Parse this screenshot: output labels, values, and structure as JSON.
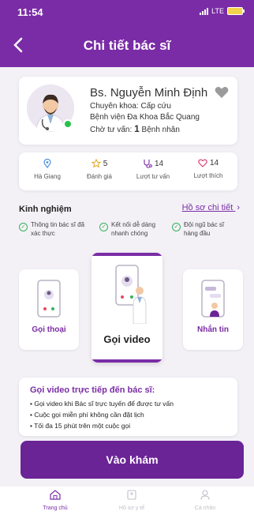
{
  "status_bar": {
    "time": "11:54",
    "network": "LTE"
  },
  "header": {
    "title": "Chi tiết bác sĩ"
  },
  "doctor": {
    "name": "Bs. Nguyễn Minh Định",
    "specialty_label": "Chuyên khoa:",
    "specialty": "Cấp cứu",
    "hospital": "Bệnh viện Đa Khoa Bắc Quang",
    "waiting_label": "Chờ tư vấn:",
    "waiting_count": "1",
    "waiting_unit": "Bệnh nhân"
  },
  "stats": [
    {
      "icon": "location-icon",
      "value": "",
      "label": "Hà Giang"
    },
    {
      "icon": "star-icon",
      "value": "5",
      "label": "Đánh giá"
    },
    {
      "icon": "stethoscope-icon",
      "value": "14",
      "label": "Lượt tư vấn"
    },
    {
      "icon": "heart-icon",
      "value": "14",
      "label": "Lượt thích"
    }
  ],
  "experience": {
    "title": "Kinh nghiệm",
    "link": "Hồ sơ chi tiết",
    "features": [
      {
        "line1": "Thông tin bác sĩ đã",
        "line2": "xác thực"
      },
      {
        "line1": "Kết nối dễ dàng",
        "line2": "nhanh chóng"
      },
      {
        "line1": "Đội ngũ bác sĩ",
        "line2": "hàng đầu"
      }
    ]
  },
  "call_options": {
    "voice": "Gọi thoại",
    "video": "Gọi video",
    "message": "Nhắn tin"
  },
  "info": {
    "title": "Gọi video trực tiếp đến bác sĩ:",
    "lines": [
      "• Gọi video khi Bác sĩ trực tuyến để được tư vấn",
      "• Cuộc gọi miễn phí không cần đặt lịch",
      "• Tối đa 15 phút trên một cuộc gọi"
    ]
  },
  "cta": {
    "label": "Vào khám"
  },
  "bottom_nav": [
    {
      "icon": "home-icon",
      "label": "Trang chủ",
      "active": true
    },
    {
      "icon": "records-icon",
      "label": "Hồ sơ y tế",
      "active": false
    },
    {
      "icon": "user-icon",
      "label": "Cá nhân",
      "active": false
    }
  ],
  "colors": {
    "primary": "#7a2ca6",
    "cta": "#6a2496",
    "online": "#27c24c",
    "check": "#34b35a"
  }
}
